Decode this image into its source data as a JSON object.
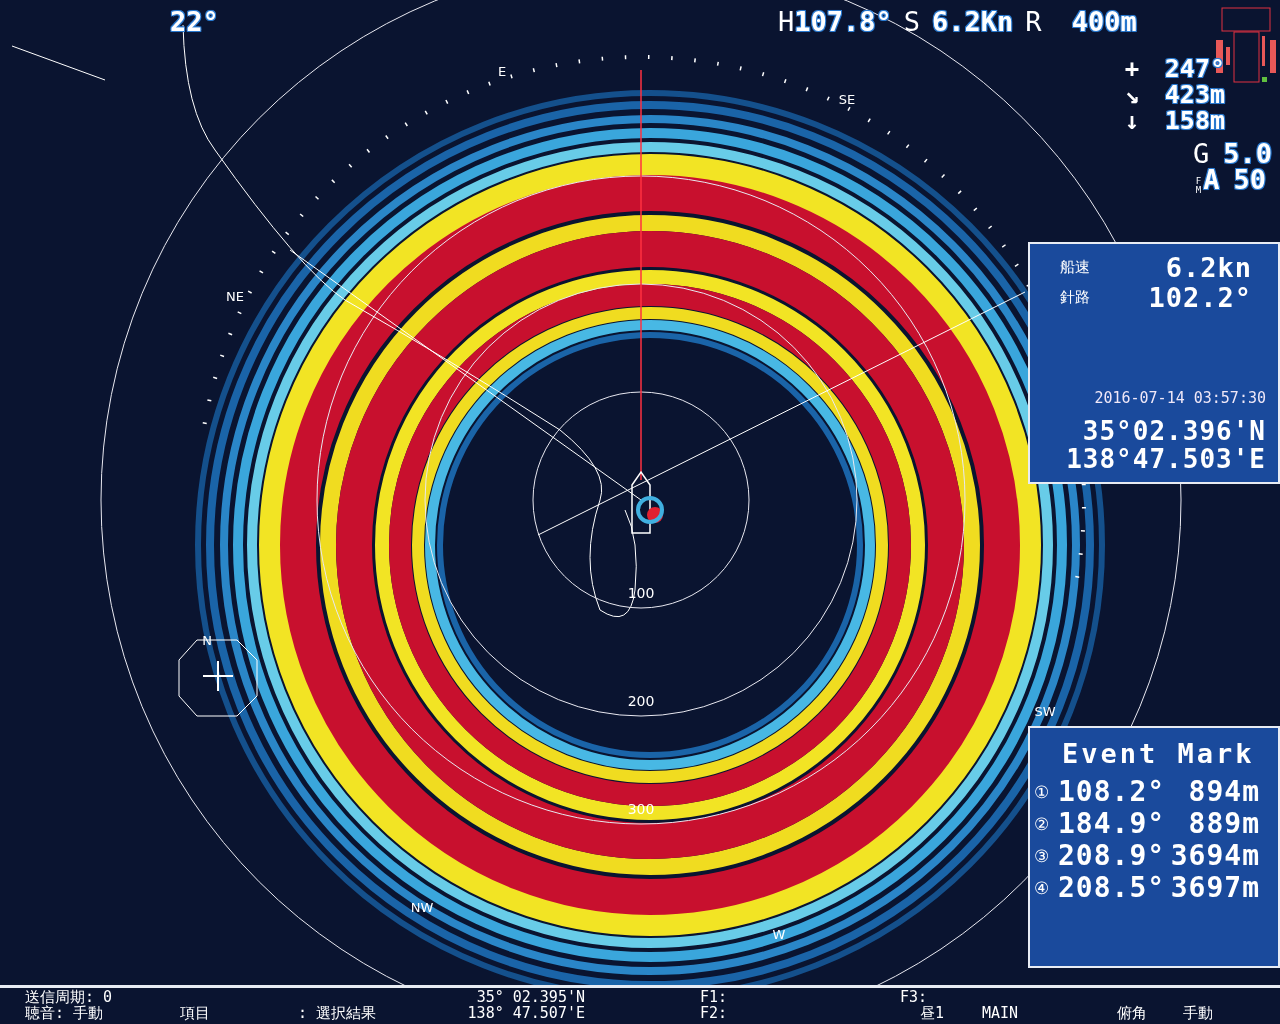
{
  "header": {
    "bearing": "22°",
    "heading_label": "H",
    "heading": "107.8°",
    "speed_label": "S",
    "speed": "6.2Kn",
    "range_label": "R",
    "range": "400m"
  },
  "target": [
    {
      "symbol": "+",
      "value": "247°"
    },
    {
      "symbol": "↘",
      "value": "423m"
    },
    {
      "symbol": "↓",
      "value": "158m"
    }
  ],
  "gain": {
    "label": "G",
    "value": "5.0"
  },
  "mode": {
    "marks": [
      "F",
      "M"
    ],
    "label": "A",
    "value": "50"
  },
  "compass_labels": [
    "E",
    "SE",
    "NE",
    "N",
    "SW",
    "NW",
    "W"
  ],
  "range_labels": [
    "100",
    "200",
    "300"
  ],
  "nav_panel": {
    "rows": [
      {
        "label": "船速",
        "value": "6.2kn"
      },
      {
        "label": "針路",
        "value": "102.2°"
      }
    ],
    "timestamp": "2016-07-14 03:57:30",
    "latitude": "35°02.396'N",
    "longitude": "138°47.503'E"
  },
  "event_mark": {
    "title": "Event Mark",
    "marks": [
      {
        "index": "①",
        "bearing": "108.2°",
        "distance": "894m"
      },
      {
        "index": "②",
        "bearing": "184.9°",
        "distance": "889m"
      },
      {
        "index": "③",
        "bearing": "208.9°",
        "distance": "3694m"
      },
      {
        "index": "④",
        "bearing": "208.5°",
        "distance": "3697m"
      }
    ]
  },
  "status_bar": {
    "items": [
      "送信周期:  0",
      "35° 02.395'N",
      "F1:",
      "F3:",
      "聴音: 手動",
      "項目",
      ": 選択結果",
      "138° 47.507'E",
      "F2:",
      "昼1",
      "MAIN",
      "俯角",
      "手動"
    ]
  }
}
